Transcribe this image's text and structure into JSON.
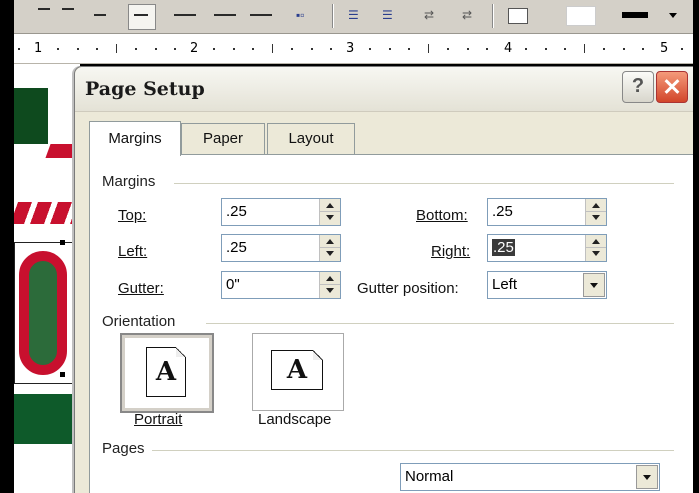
{
  "ruler": {
    "numbers": [
      "1",
      "2",
      "3",
      "4",
      "5"
    ]
  },
  "dialog": {
    "title": "Page Setup",
    "help_glyph": "?",
    "tabs": [
      "Margins",
      "Paper",
      "Layout"
    ],
    "margins_group": "Margins",
    "fields": {
      "top": {
        "label": "Top:",
        "value": ".25"
      },
      "left": {
        "label": "Left:",
        "value": ".25"
      },
      "gutter": {
        "label": "Gutter:",
        "value": "0\""
      },
      "bottom": {
        "label": "Bottom:",
        "value": ".25"
      },
      "right": {
        "label": "Right:",
        "value": ".25"
      },
      "gutter_position": {
        "label": "Gutter position:",
        "value": "Left"
      }
    },
    "orientation_group": "Orientation",
    "orientation": {
      "portrait": "Portrait",
      "landscape": "Landscape",
      "selected": "Portrait",
      "glyph": "A"
    },
    "pages_group": "Pages",
    "pages_select": "Normal"
  },
  "colors": {
    "dialog_bg": "#ece9d8",
    "close_button": "#d2452a",
    "field_border": "#7f9db9"
  }
}
